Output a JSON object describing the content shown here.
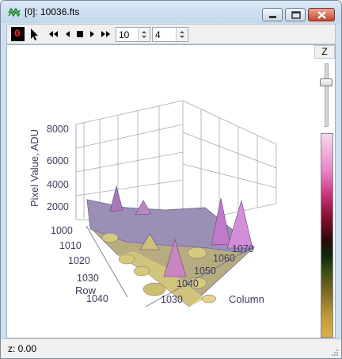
{
  "window": {
    "title": "[0]: 10036.fts"
  },
  "toolbar": {
    "frame_indicator": "0",
    "frame_value": "10",
    "step_value": "4"
  },
  "plot": {
    "z_ticks": [
      "8000",
      "6000",
      "4000",
      "2000"
    ],
    "z_label": "Pixel Value, ADU",
    "row_ticks": [
      "1000",
      "1010",
      "1020",
      "1030",
      "1040"
    ],
    "row_label": "Row",
    "col_ticks": [
      "1030",
      "1040",
      "1050",
      "1060",
      "1070"
    ],
    "col_label": "Column"
  },
  "side": {
    "z_button": "Z"
  },
  "status": {
    "text": "z: 0.00"
  },
  "colors": {
    "titlebar": "#c3d7ec",
    "surface_low": "#cfc07a",
    "surface_high": "#b07ab8"
  }
}
